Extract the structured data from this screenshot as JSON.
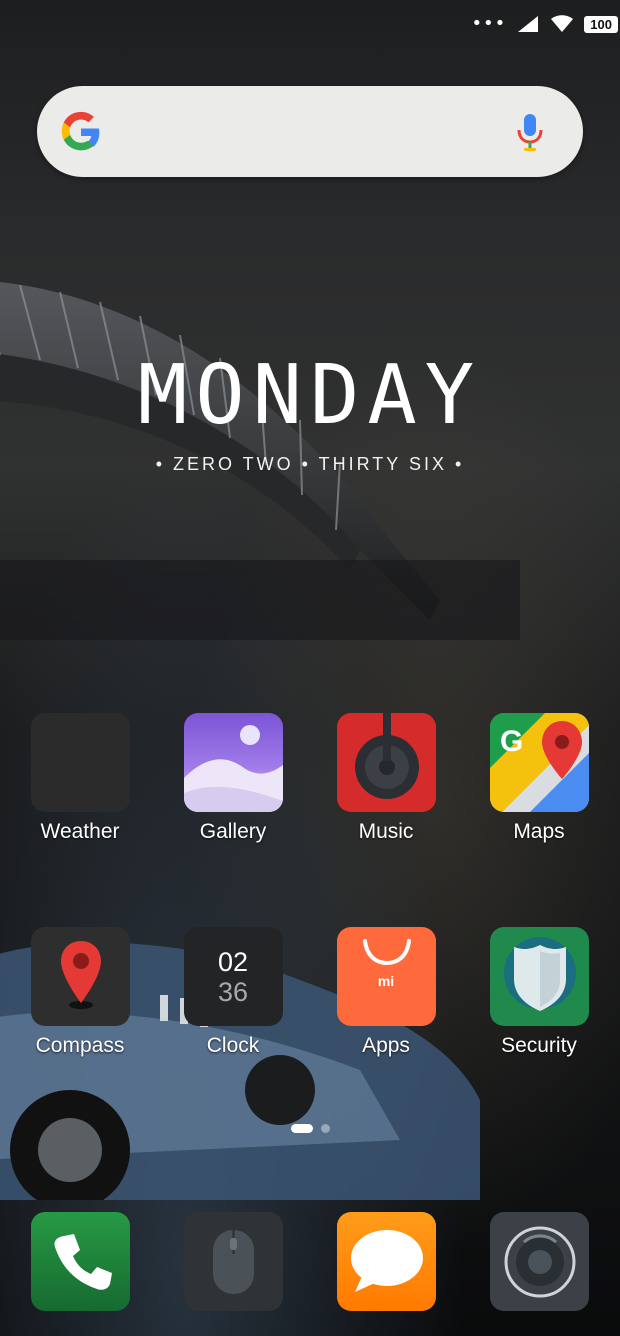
{
  "status_bar": {
    "dots": "•••",
    "battery": "100"
  },
  "search_bar": {
    "icons": [
      "google-icon",
      "microphone-icon"
    ]
  },
  "clock_widget": {
    "day": "MONDAY",
    "time_words": "• ZERO TWO • THIRTY SIX •"
  },
  "apps": {
    "row1": [
      {
        "label": "Weather",
        "icon": "weather-icon",
        "color": "#2b2b2b"
      },
      {
        "label": "Gallery",
        "icon": "gallery-icon",
        "color": "#8a5cd8"
      },
      {
        "label": "Music",
        "icon": "music-icon",
        "color": "#d62b2b"
      },
      {
        "label": "Maps",
        "icon": "maps-icon",
        "color": "#4a8cf0"
      }
    ],
    "row2": [
      {
        "label": "Compass",
        "icon": "compass-icon",
        "color": "#2e2e2e"
      },
      {
        "label": "Clock",
        "icon": "clock-icon",
        "color": "#232425",
        "hour": "02",
        "minute": "36"
      },
      {
        "label": "Apps",
        "icon": "mi-store-icon",
        "color": "#ff6a3c",
        "badge": "mi"
      },
      {
        "label": "Security",
        "icon": "security-shield-icon",
        "color": "#1f8a4c"
      }
    ]
  },
  "pager": {
    "pages": 2,
    "current": 1
  },
  "dock": [
    {
      "icon": "phone-icon",
      "color": "#1f7a3a"
    },
    {
      "icon": "mouse-icon",
      "color": "#2f3336"
    },
    {
      "icon": "messaging-icon",
      "color": "#ff8a00"
    },
    {
      "icon": "camera-icon",
      "color": "#3b4146"
    }
  ]
}
